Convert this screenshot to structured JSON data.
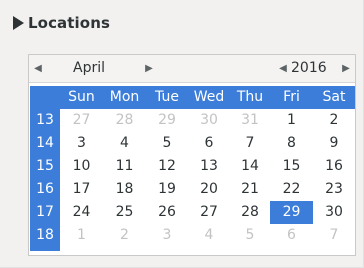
{
  "section": {
    "title": "Locations"
  },
  "calendar": {
    "month": "April",
    "year": "2016",
    "prev_month_glyph": "◀",
    "next_month_glyph": "▶",
    "prev_year_glyph": "◀",
    "next_year_glyph": "▶",
    "weekdays": [
      "Sun",
      "Mon",
      "Tue",
      "Wed",
      "Thu",
      "Fri",
      "Sat"
    ],
    "week_numbers": [
      "13",
      "14",
      "15",
      "16",
      "17",
      "18"
    ],
    "weeks": [
      [
        {
          "d": "27",
          "o": true
        },
        {
          "d": "28",
          "o": true
        },
        {
          "d": "29",
          "o": true
        },
        {
          "d": "30",
          "o": true
        },
        {
          "d": "31",
          "o": true
        },
        {
          "d": "1"
        },
        {
          "d": "2"
        }
      ],
      [
        {
          "d": "3"
        },
        {
          "d": "4"
        },
        {
          "d": "5"
        },
        {
          "d": "6"
        },
        {
          "d": "7"
        },
        {
          "d": "8"
        },
        {
          "d": "9"
        }
      ],
      [
        {
          "d": "10"
        },
        {
          "d": "11"
        },
        {
          "d": "12"
        },
        {
          "d": "13"
        },
        {
          "d": "14"
        },
        {
          "d": "15"
        },
        {
          "d": "16"
        }
      ],
      [
        {
          "d": "17"
        },
        {
          "d": "18"
        },
        {
          "d": "19"
        },
        {
          "d": "20"
        },
        {
          "d": "21"
        },
        {
          "d": "22"
        },
        {
          "d": "23"
        }
      ],
      [
        {
          "d": "24"
        },
        {
          "d": "25"
        },
        {
          "d": "26"
        },
        {
          "d": "27"
        },
        {
          "d": "28"
        },
        {
          "d": "29",
          "sel": true
        },
        {
          "d": "30"
        }
      ],
      [
        {
          "d": "1",
          "o": true
        },
        {
          "d": "2",
          "o": true
        },
        {
          "d": "3",
          "o": true
        },
        {
          "d": "4",
          "o": true
        },
        {
          "d": "5",
          "o": true
        },
        {
          "d": "6",
          "o": true
        },
        {
          "d": "7",
          "o": true
        }
      ]
    ],
    "colors": {
      "accent": "#3b7dd8",
      "text": "#2e3436",
      "other_month": "#c3c3c3"
    }
  }
}
